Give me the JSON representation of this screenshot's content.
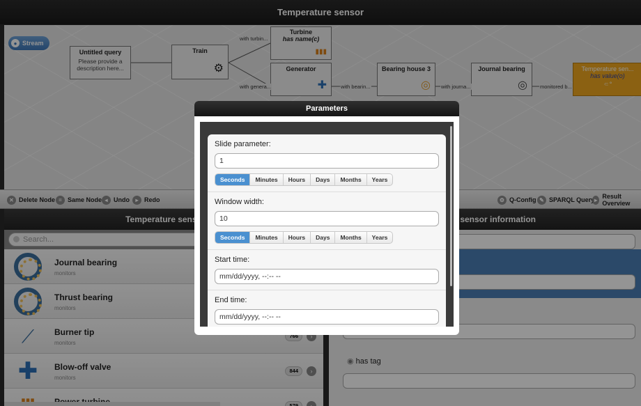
{
  "app": {
    "title": "Temperature sensor"
  },
  "canvas": {
    "stream_label": "Stream",
    "nodes": {
      "untitled": {
        "title": "Untitled query",
        "desc1": "Please provide a",
        "desc2": "description here..."
      },
      "train": {
        "title": "Train"
      },
      "turbine": {
        "title": "Turbine",
        "sub": "has name(c)"
      },
      "generator": {
        "title": "Generator"
      },
      "bearing_house": {
        "title": "Bearing house 3"
      },
      "journal": {
        "title": "Journal bearing"
      },
      "temp": {
        "title": "Temperature sen...",
        "sub": "has value(o)"
      }
    },
    "edges": {
      "e1": "with turbin...",
      "e2": "with genera...",
      "e3": "with bearin...",
      "e4": "with journa...",
      "e5": "monitored b..."
    }
  },
  "toolbar": {
    "delete": "Delete Node",
    "same": "Same Node",
    "undo": "Undo",
    "redo": "Redo",
    "qconfig": "Q-Config",
    "sparql": "SPARQL Query",
    "results": "Result Overview"
  },
  "left_panel": {
    "title": "Temperature senso",
    "search_placeholder": "Search...",
    "items": [
      {
        "title": "Journal bearing",
        "sub": "monitors",
        "count": ""
      },
      {
        "title": "Thrust bearing",
        "sub": "monitors",
        "count": ""
      },
      {
        "title": "Burner tip",
        "sub": "monitors",
        "count": "766"
      },
      {
        "title": "Blow-off valve",
        "sub": "monitors",
        "count": "844"
      },
      {
        "title": "Power turbine",
        "sub": "",
        "count": "579"
      }
    ]
  },
  "right_panel": {
    "title": "rature sensor information",
    "tag_label": "has tag"
  },
  "modal": {
    "title": "Parameters",
    "slide_label": "Slide parameter:",
    "slide_value": "1",
    "window_label": "Window width:",
    "window_value": "10",
    "units": [
      "Seconds",
      "Minutes",
      "Hours",
      "Days",
      "Months",
      "Years"
    ],
    "start_label": "Start time:",
    "start_placeholder": "mm/dd/yyyy, --:-- --",
    "end_label": "End time:",
    "end_placeholder": "mm/dd/yyyy, --:-- --"
  }
}
